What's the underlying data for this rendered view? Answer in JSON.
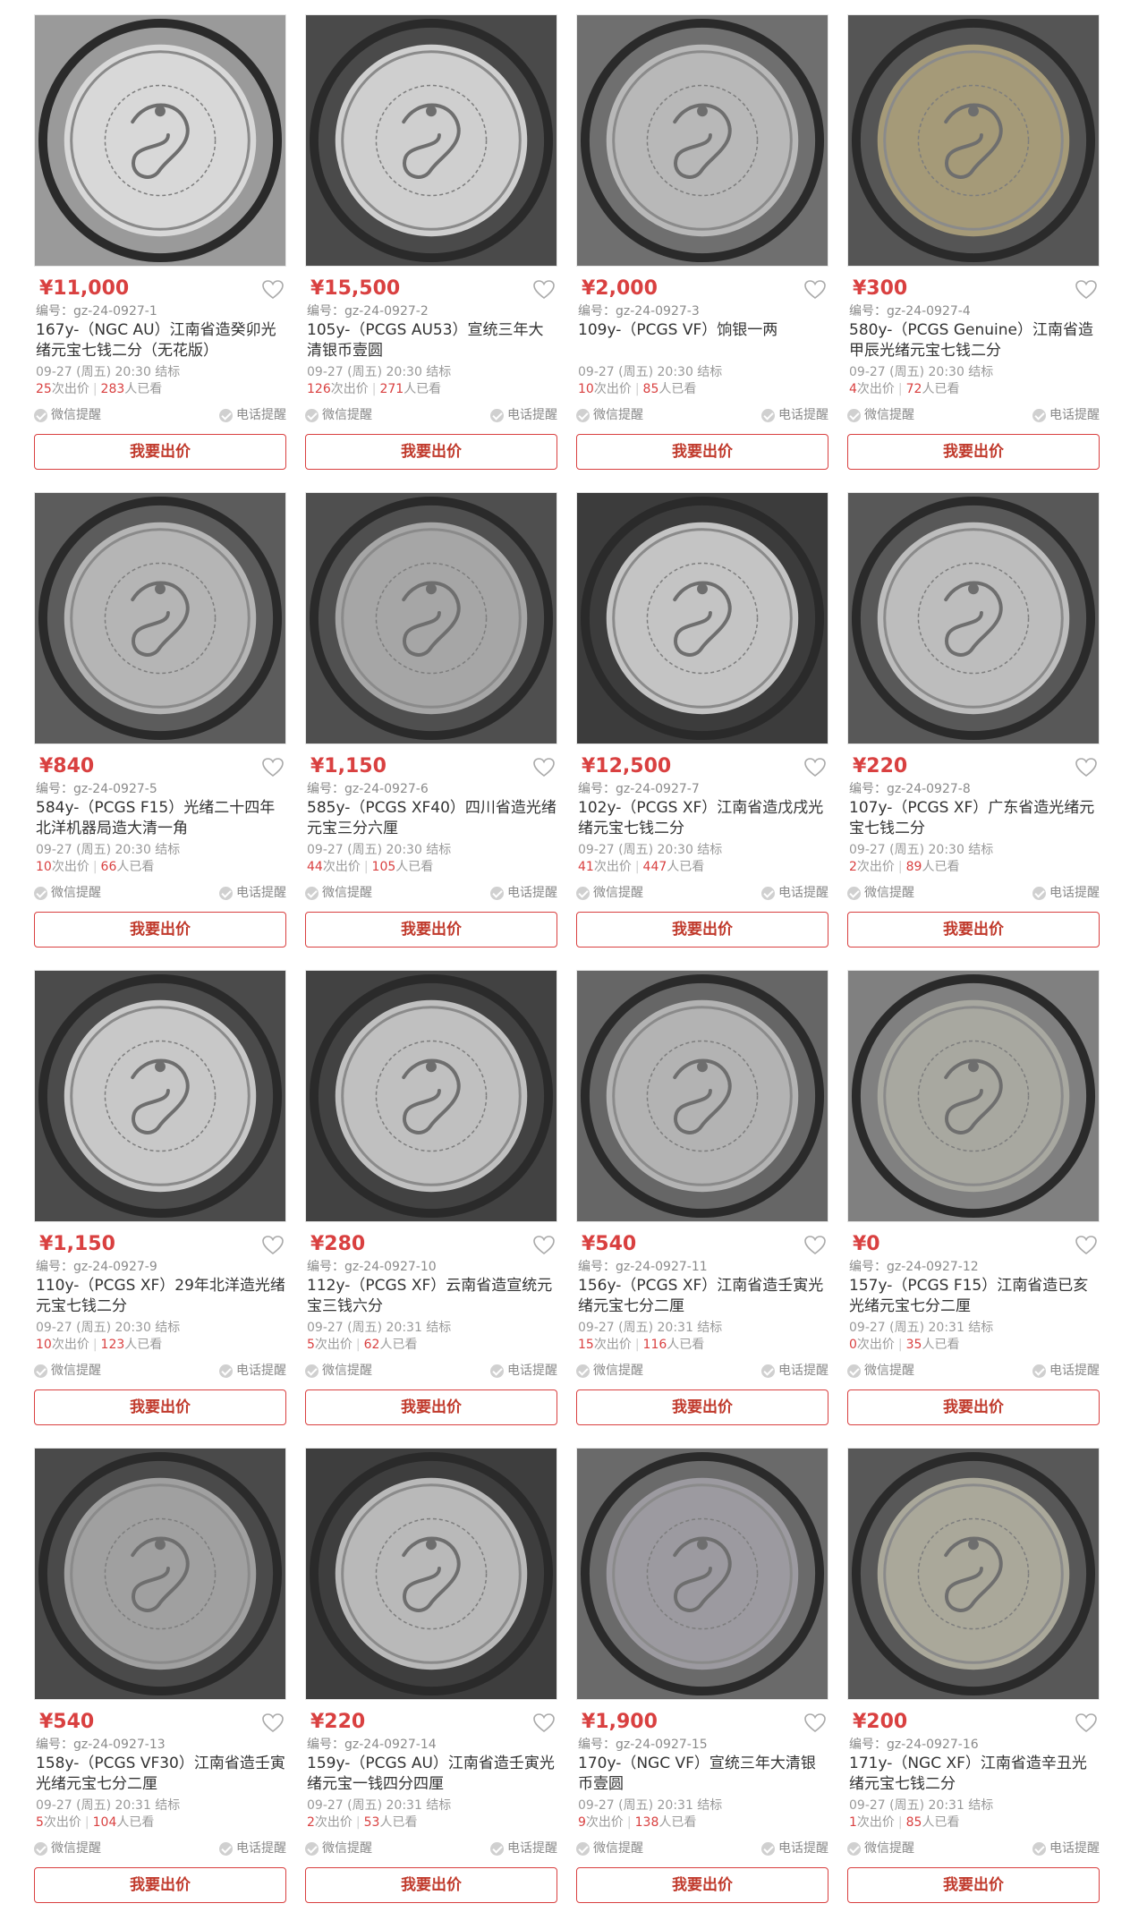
{
  "ui": {
    "serial_prefix": "编号：",
    "bids_suffix": "次出价",
    "views_suffix": "人已看",
    "wechat_remind": "微信提醒",
    "phone_remind": "电话提醒",
    "bid_button": "我要出价"
  },
  "colors": {
    "accent": "#d94040",
    "muted": "#999999"
  },
  "items": [
    {
      "price": "¥11,000",
      "serial": "gz-24-0927-1",
      "title": "167y-（NGC AU）江南省造癸卯光绪元宝七钱二分（无花版）",
      "end": "09-27 (周五) 20:30 结标",
      "bids": "25",
      "views": "283",
      "tone": "#d8d8d8",
      "bg": "#9a9a9a"
    },
    {
      "price": "¥15,500",
      "serial": "gz-24-0927-2",
      "title": "105y-（PCGS AU53）宣统三年大清银币壹圆",
      "end": "09-27 (周五) 20:30 结标",
      "bids": "126",
      "views": "271",
      "tone": "#cfcfcf",
      "bg": "#4a4a4a"
    },
    {
      "price": "¥2,000",
      "serial": "gz-24-0927-3",
      "title": "109y-（PCGS VF）饷银一两",
      "end": "09-27 (周五) 20:30 结标",
      "bids": "10",
      "views": "85",
      "tone": "#b8b8b8",
      "bg": "#6f6f6f"
    },
    {
      "price": "¥300",
      "serial": "gz-24-0927-4",
      "title": "580y-（PCGS Genuine）江南省造甲辰光绪元宝七钱二分",
      "end": "09-27 (周五) 20:30 结标",
      "bids": "4",
      "views": "72",
      "tone": "#a59a78",
      "bg": "#555555"
    },
    {
      "price": "¥840",
      "serial": "gz-24-0927-5",
      "title": "584y-（PCGS F15）光绪二十四年北洋机器局造大清一角",
      "end": "09-27 (周五) 20:30 结标",
      "bids": "10",
      "views": "66",
      "tone": "#b5b5b5",
      "bg": "#5c5c5c"
    },
    {
      "price": "¥1,150",
      "serial": "gz-24-0927-6",
      "title": "585y-（PCGS XF40）四川省造光绪元宝三分六厘",
      "end": "09-27 (周五) 20:30 结标",
      "bids": "44",
      "views": "105",
      "tone": "#a6a6a6",
      "bg": "#4f4f4f"
    },
    {
      "price": "¥12,500",
      "serial": "gz-24-0927-7",
      "title": "102y-（PCGS XF）江南省造戊戌光绪元宝七钱二分",
      "end": "09-27 (周五) 20:30 结标",
      "bids": "41",
      "views": "447",
      "tone": "#c4c4c4",
      "bg": "#3c3c3c"
    },
    {
      "price": "¥220",
      "serial": "gz-24-0927-8",
      "title": "107y-（PCGS XF）广东省造光绪元宝七钱二分",
      "end": "09-27 (周五) 20:30 结标",
      "bids": "2",
      "views": "89",
      "tone": "#bdbdbd",
      "bg": "#585858"
    },
    {
      "price": "¥1,150",
      "serial": "gz-24-0927-9",
      "title": "110y-（PCGS XF）29年北洋造光绪元宝七钱二分",
      "end": "09-27 (周五) 20:30 结标",
      "bids": "10",
      "views": "123",
      "tone": "#c8c8c8",
      "bg": "#4b4b4b"
    },
    {
      "price": "¥280",
      "serial": "gz-24-0927-10",
      "title": "112y-（PCGS XF）云南省造宣统元宝三钱六分",
      "end": "09-27 (周五) 20:31 结标",
      "bids": "5",
      "views": "62",
      "tone": "#c0c0c0",
      "bg": "#424242"
    },
    {
      "price": "¥540",
      "serial": "gz-24-0927-11",
      "title": "156y-（PCGS XF）江南省造壬寅光绪元宝七分二厘",
      "end": "09-27 (周五) 20:31 结标",
      "bids": "15",
      "views": "116",
      "tone": "#b3b3b3",
      "bg": "#666666"
    },
    {
      "price": "¥0",
      "serial": "gz-24-0927-12",
      "title": "157y-（PCGS F15）江南省造已亥光绪元宝七分二厘",
      "end": "09-27 (周五) 20:31 结标",
      "bids": "0",
      "views": "35",
      "tone": "#a8a8a0",
      "bg": "#808080"
    },
    {
      "price": "¥540",
      "serial": "gz-24-0927-13",
      "title": "158y-（PCGS VF30）江南省造壬寅光绪元宝七分二厘",
      "end": "09-27 (周五) 20:31 结标",
      "bids": "5",
      "views": "104",
      "tone": "#a0a0a0",
      "bg": "#4a4a4a"
    },
    {
      "price": "¥220",
      "serial": "gz-24-0927-14",
      "title": "159y-（PCGS AU）江南省造壬寅光绪元宝一钱四分四厘",
      "end": "09-27 (周五) 20:31 结标",
      "bids": "2",
      "views": "53",
      "tone": "#b9b9b9",
      "bg": "#3e3e3e"
    },
    {
      "price": "¥1,900",
      "serial": "gz-24-0927-15",
      "title": "170y-（NGC VF）宣统三年大清银币壹圆",
      "end": "09-27 (周五) 20:31 结标",
      "bids": "9",
      "views": "138",
      "tone": "#9c9aa0",
      "bg": "#6a6a6a"
    },
    {
      "price": "¥200",
      "serial": "gz-24-0927-16",
      "title": "171y-（NGC XF）江南省造辛丑光绪元宝七钱二分",
      "end": "09-27 (周五) 20:31 结标",
      "bids": "1",
      "views": "85",
      "tone": "#aaa89a",
      "bg": "#585858"
    }
  ]
}
